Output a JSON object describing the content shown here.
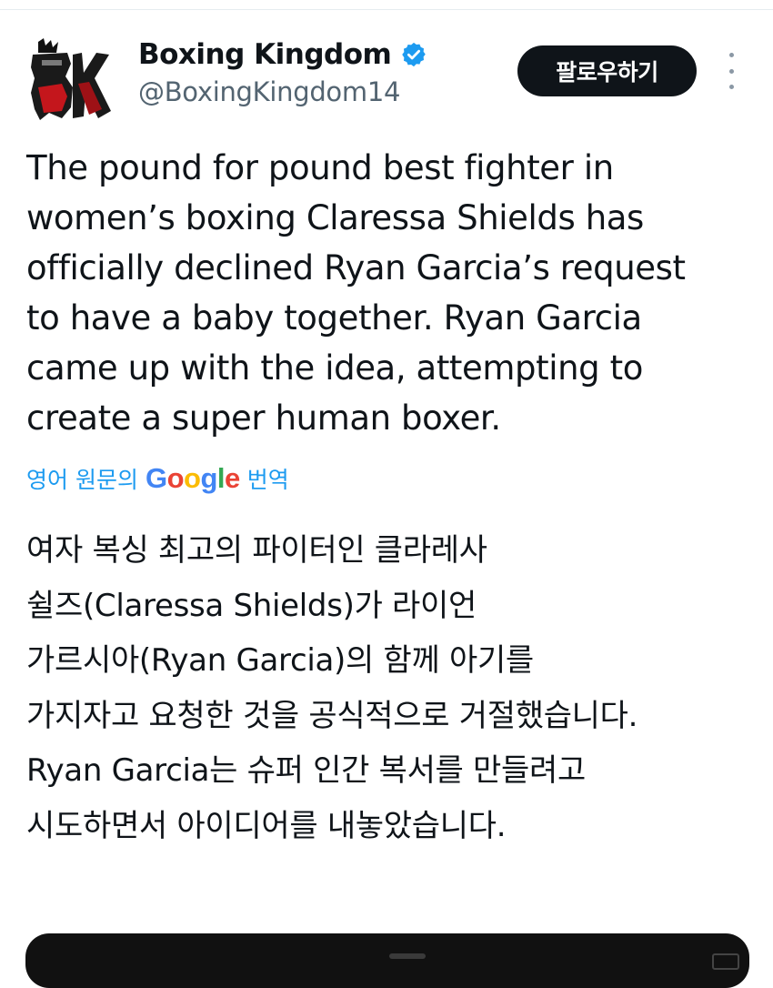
{
  "account": {
    "logo_text": "BK",
    "name": "Boxing Kingdom",
    "handle": "@BoxingKingdom14",
    "verified_icon": "verified-badge-icon",
    "verified_color": "#1d9bf0"
  },
  "actions": {
    "follow_label": "팔로우하기",
    "more_icon": "more-vertical-icon"
  },
  "tweet": {
    "text_lines": [
      "The pound for pound best fighter in",
      "women’s boxing Claressa Shields has",
      "officially declined Ryan Garcia’s request",
      "to have a baby together. Ryan Garcia",
      "came up with the idea, attempting to",
      "create a super human boxer."
    ]
  },
  "translation": {
    "prefix": "영어 원문의",
    "brand": "Google",
    "suffix": "번역",
    "link_color": "#1d9bf0",
    "text_lines": [
      "여자 복싱 최고의 파이터인 클라레사",
      "쉴즈(Claressa Shields)가 라이언",
      "가르시아(Ryan Garcia)의 함께 아기를",
      "가지자고 요청한 것을 공식적으로 거절했습니다.",
      "Ryan Garcia는 슈퍼 인간 복서를 만들려고",
      "시도하면서 아이디어를 내놓았습니다."
    ]
  },
  "media": {
    "kind": "video-thumbnail"
  }
}
